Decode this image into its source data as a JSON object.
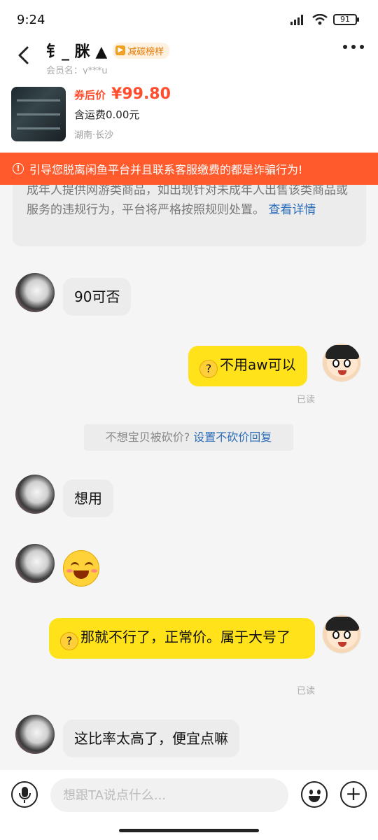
{
  "status_bar": {
    "time": "9:24",
    "battery": "91"
  },
  "header": {
    "seller_name": "钅_ 脒 ▲",
    "badge": "减碳榜样",
    "member_name": "会员名：y***u"
  },
  "product": {
    "price_label": "券后价",
    "price": "¥99.80",
    "shipping": "含运费0.00元",
    "location": "湖南·长沙"
  },
  "warning": {
    "text": "引导您脱离闲鱼平台并且联系客服缴费的都是诈骗行为!"
  },
  "notice": {
    "text": "成年人提供网游类商品，如出现针对未成年人出售该类商品或服务的违规行为，平台将严格按照规则处置。",
    "link": "查看详情"
  },
  "messages": [
    {
      "from": "other",
      "text": "90可否"
    },
    {
      "from": "self",
      "text": "不用aw可以",
      "status": "已读"
    },
    {
      "from": "other",
      "text": "想用"
    },
    {
      "from": "other",
      "text": ""
    },
    {
      "from": "self",
      "text": "那就不行了，正常价。属于大号了",
      "status": "已读"
    },
    {
      "from": "other",
      "text": "这比率太高了，便宜点嘛"
    }
  ],
  "system_tip": {
    "text": "不想宝贝被砍价?",
    "link": "设置不砍价回复"
  },
  "input_bar": {
    "placeholder": "想跟TA说点什么..."
  },
  "colors": {
    "accent": "#ffe21a",
    "warning": "#ff5a2c",
    "price": "#ff4d2d",
    "link": "#2a6cb8"
  },
  "icons": [
    "back-arrow-icon",
    "more-icon",
    "microphone-icon",
    "emoji-icon",
    "plus-icon",
    "thinking-emoji-icon",
    "smile-emoji-icon"
  ]
}
